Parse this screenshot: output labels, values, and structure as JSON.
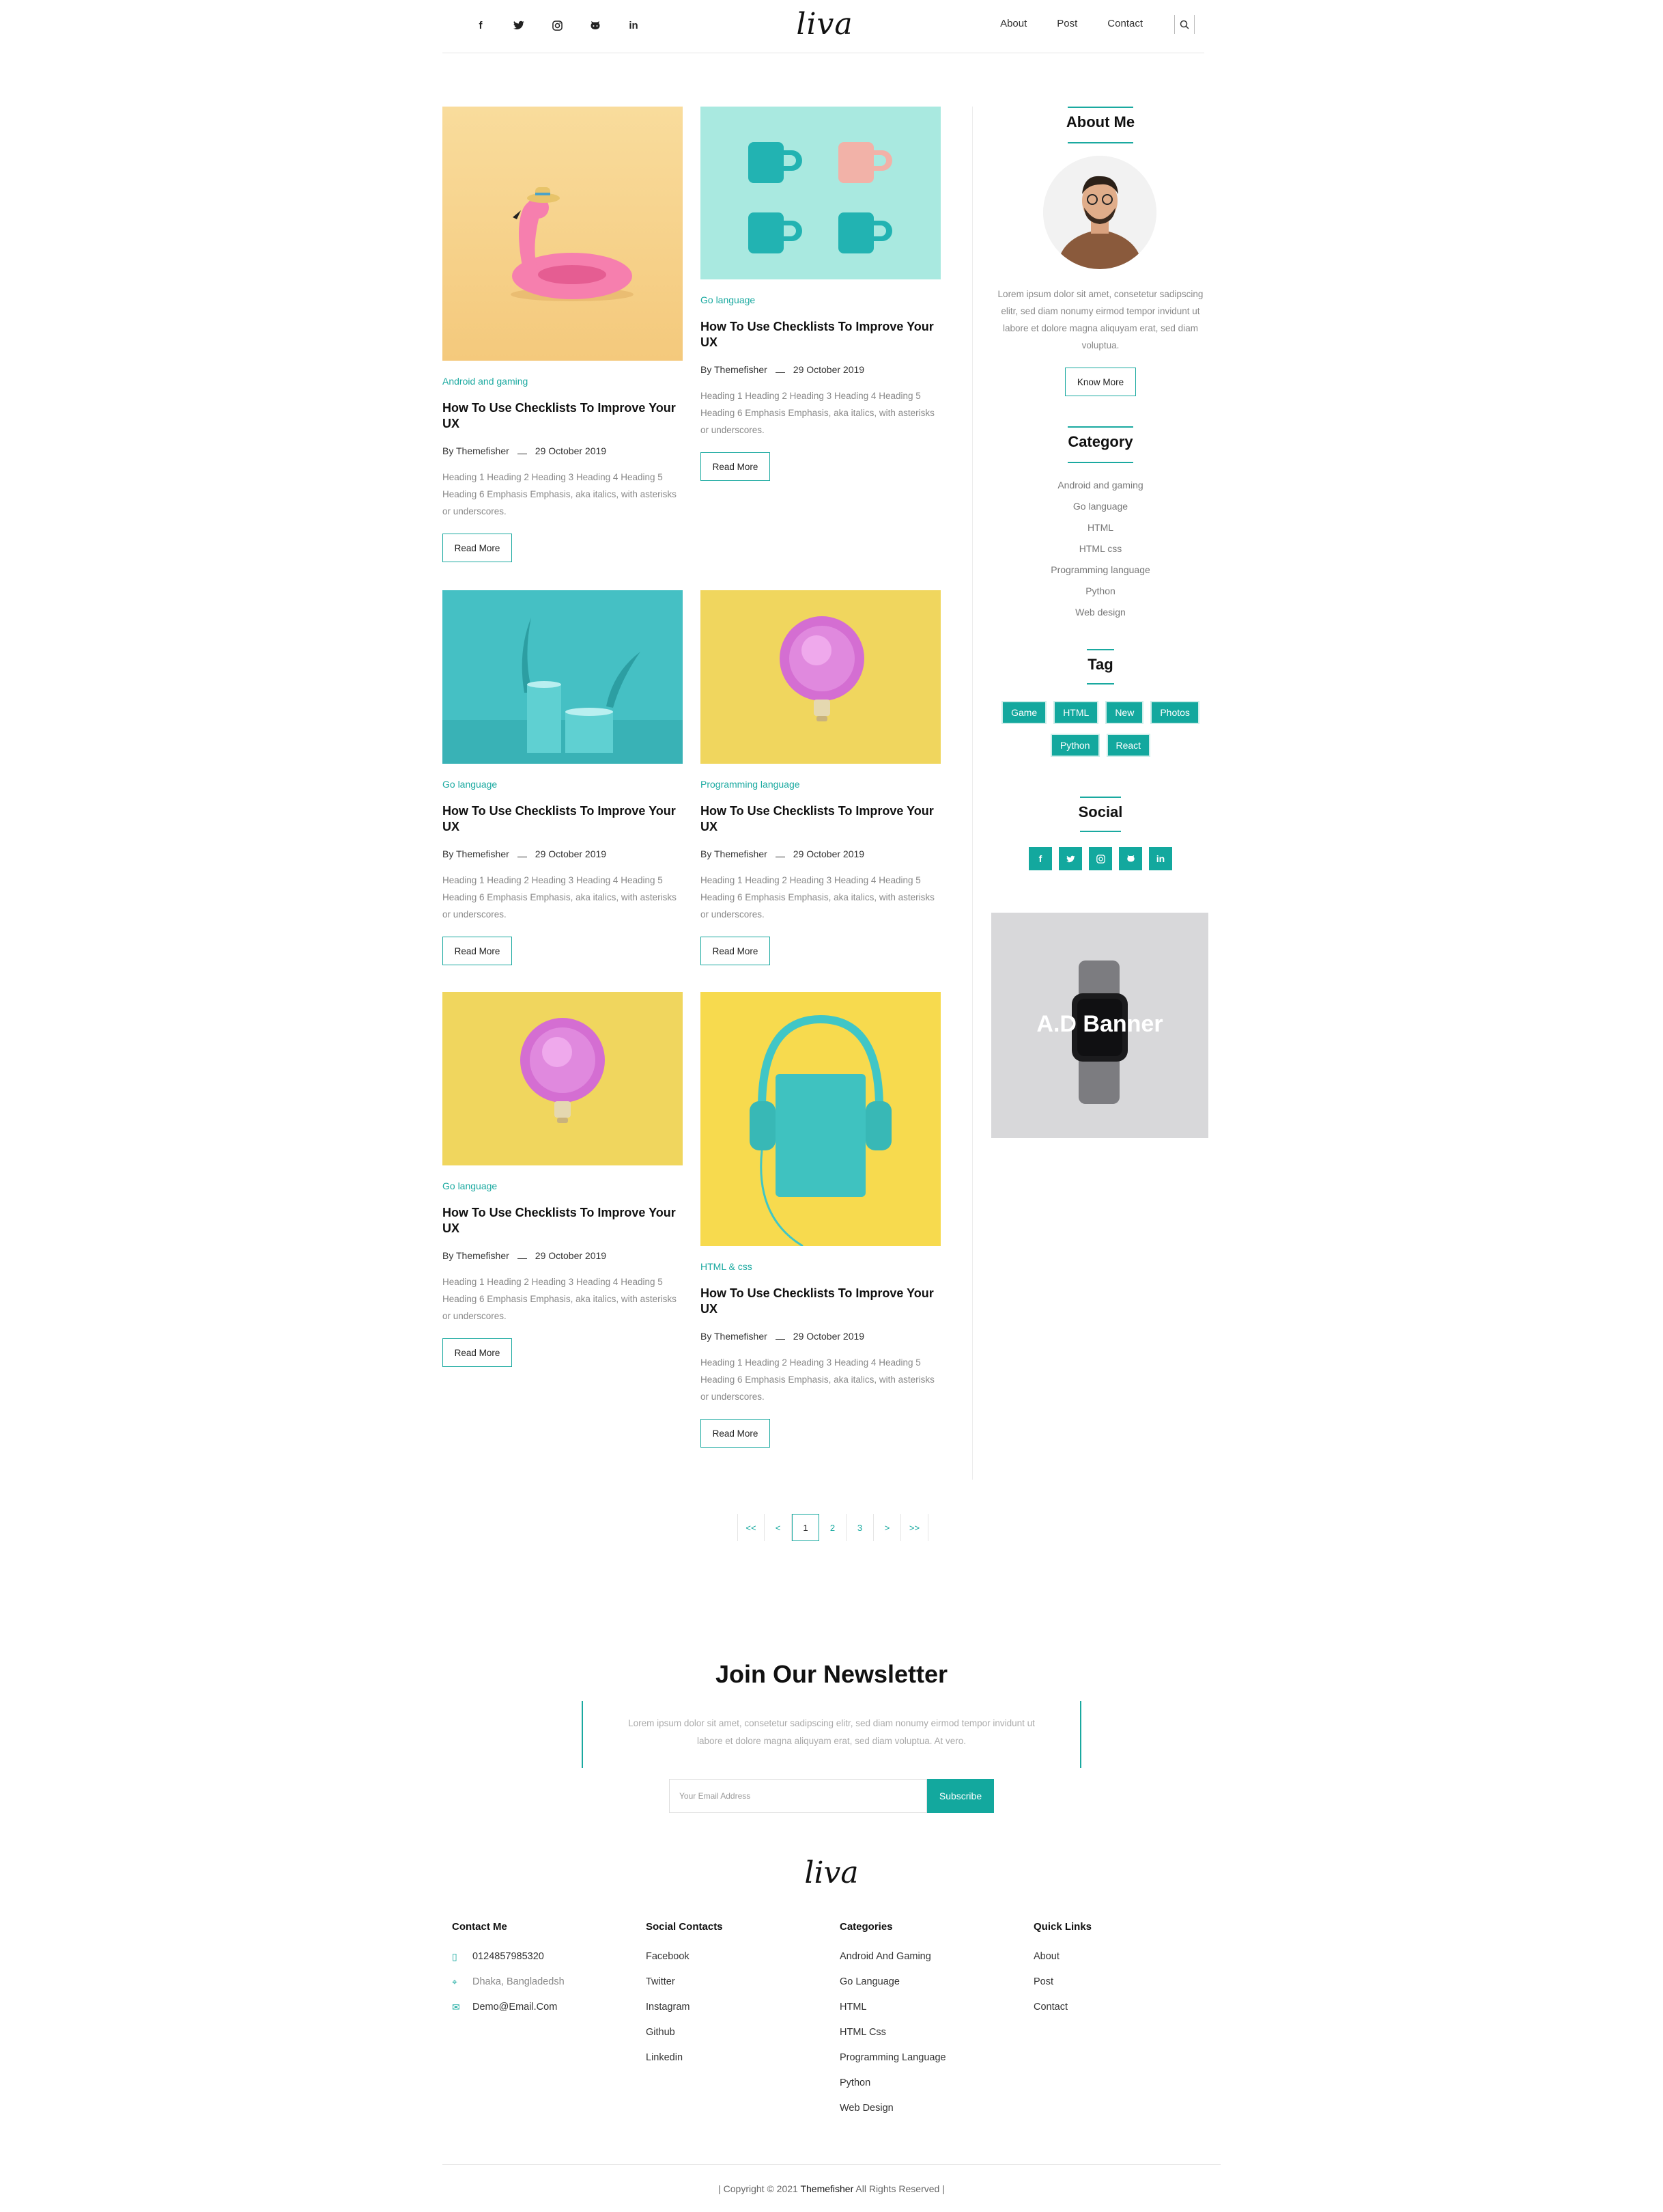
{
  "header": {
    "logo": "liva",
    "socials": [
      "f",
      "t",
      "ig",
      "gh",
      "in"
    ],
    "nav": [
      "About",
      "Post",
      "Contact"
    ],
    "search_icon": "search-icon"
  },
  "posts": [
    {
      "category": "Android and gaming",
      "title": "How To Use Checklists To Improve Your UX",
      "author": "By Themefisher",
      "date": "29 October 2019",
      "excerpt": "Heading 1 Heading 2 Heading 3 Heading 4 Heading 5 Heading 6 Emphasis Emphasis, aka italics, with asterisks or underscores.",
      "button": "Read More",
      "image": "flamingo"
    },
    {
      "category": "Go language",
      "title": "How To Use Checklists To Improve Your UX",
      "author": "By Themefisher",
      "date": "29 October 2019",
      "excerpt": "Heading 1 Heading 2 Heading 3 Heading 4 Heading 5 Heading 6 Emphasis Emphasis, aka italics, with asterisks or underscores.",
      "button": "Read More",
      "image": "mugs"
    },
    {
      "category": "Go language",
      "title": "How To Use Checklists To Improve Your UX",
      "author": "By Themefisher",
      "date": "29 October 2019",
      "excerpt": "Heading 1 Heading 2 Heading 3 Heading 4 Heading 5 Heading 6 Emphasis Emphasis, aka italics, with asterisks or underscores.",
      "button": "Read More",
      "image": "podium"
    },
    {
      "category": "Programming language",
      "title": "How To Use Checklists To Improve Your UX",
      "author": "By Themefisher",
      "date": "29 October 2019",
      "excerpt": "Heading 1 Heading 2 Heading 3 Heading 4 Heading 5 Heading 6 Emphasis Emphasis, aka italics, with asterisks or underscores.",
      "button": "Read More",
      "image": "fluffy-bulb"
    },
    {
      "category": "Go language",
      "title": "How To Use Checklists To Improve Your UX",
      "author": "By Themefisher",
      "date": "29 October 2019",
      "excerpt": "Heading 1 Heading 2 Heading 3 Heading 4 Heading 5 Heading 6 Emphasis Emphasis, aka italics, with asterisks or underscores.",
      "button": "Read More",
      "image": "fluffy-bulb"
    },
    {
      "category": "HTML & css",
      "title": "How To Use Checklists To Improve Your UX",
      "author": "By Themefisher",
      "date": "29 October 2019",
      "excerpt": "Heading 1 Heading 2 Heading 3 Heading 4 Heading 5 Heading 6 Emphasis Emphasis, aka italics, with asterisks or underscores.",
      "button": "Read More",
      "image": "headphones"
    }
  ],
  "sidebar": {
    "about": {
      "title": "About Me",
      "text": "Lorem ipsum dolor sit amet, consetetur sadipscing elitr, sed diam nonumy eirmod tempor invidunt ut labore et dolore magna aliquyam erat, sed diam voluptua.",
      "button": "Know More"
    },
    "category": {
      "title": "Category",
      "items": [
        "Android and gaming",
        "Go language",
        "HTML",
        "HTML css",
        "Programming language",
        "Python",
        "Web design"
      ]
    },
    "tag": {
      "title": "Tag",
      "items": [
        "Game",
        "HTML",
        "New",
        "Photos",
        "Python",
        "React"
      ]
    },
    "social": {
      "title": "Social",
      "items": [
        "f",
        "t",
        "ig",
        "gh",
        "in"
      ]
    },
    "ad": {
      "text": "A.D Banner"
    }
  },
  "pagination": [
    "<<",
    "<",
    "1",
    "2",
    "3",
    ">",
    ">>"
  ],
  "newsletter": {
    "title": "Join Our Newsletter",
    "text": "Lorem ipsum dolor sit amet, consetetur sadipscing elitr, sed diam nonumy eirmod tempor invidunt ut labore et dolore magna aliquyam erat, sed diam voluptua. At vero.",
    "placeholder": "Your Email Address",
    "button": "Subscribe"
  },
  "footer": {
    "logo": "liva",
    "contact": {
      "title": "Contact Me",
      "phone": "0124857985320",
      "address": "Dhaka, Bangladedsh",
      "email": "Demo@Email.Com"
    },
    "social": {
      "title": "Social Contacts",
      "items": [
        "Facebook",
        "Twitter",
        "Instagram",
        "Github",
        "Linkedin"
      ]
    },
    "categories": {
      "title": "Categories",
      "items": [
        "Android And Gaming",
        "Go Language",
        "HTML",
        "HTML Css",
        "Programming Language",
        "Python",
        "Web Design"
      ]
    },
    "links": {
      "title": "Quick Links",
      "items": [
        "About",
        "Post",
        "Contact"
      ]
    },
    "copyright_prefix": "| Copyright © 2021 ",
    "copyright_brand": "Themefisher",
    "copyright_suffix": " All Rights Reserved |"
  },
  "colors": {
    "accent": "#13a89e"
  }
}
